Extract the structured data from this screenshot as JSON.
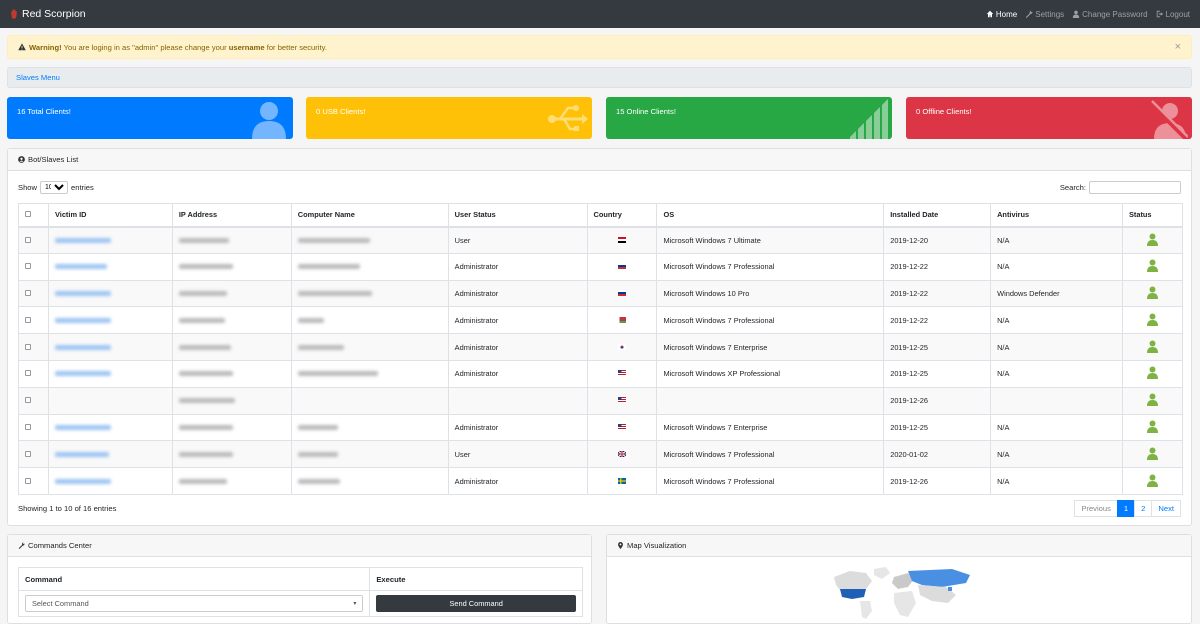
{
  "app": {
    "title": "Red Scorpion"
  },
  "nav": [
    {
      "label": "Home",
      "icon": "home-icon",
      "active": true
    },
    {
      "label": "Settings",
      "icon": "wrench-icon",
      "active": false
    },
    {
      "label": "Change Password",
      "icon": "user-icon",
      "active": false
    },
    {
      "label": "Logout",
      "icon": "logout-icon",
      "active": false
    }
  ],
  "alert": {
    "strong": "Warning!",
    "text_before": " You are loging in as \"admin\" please change your ",
    "emphasis": "username",
    "text_after": " for better security.",
    "close": "×"
  },
  "menu": {
    "label": "Slaves Menu"
  },
  "stats": [
    {
      "label": "16 Total Clients!",
      "color": "#007bff",
      "icon": "user-icon"
    },
    {
      "label": "0 USB Clients!",
      "color": "#ffc107",
      "icon": "usb-icon"
    },
    {
      "label": "15 Online Clients!",
      "color": "#28a745",
      "icon": "signal-icon"
    },
    {
      "label": "0 Offline Clients!",
      "color": "#dc3545",
      "icon": "user-slash-icon"
    }
  ],
  "slaves": {
    "title": "Bot/Slaves List",
    "show_label": "Show",
    "entries_value": "10",
    "entries_label": "entries",
    "search_label": "Search:",
    "columns": [
      "Victim ID",
      "IP Address",
      "Computer Name",
      "User Status",
      "Country",
      "OS",
      "Installed Date",
      "Antivirus",
      "Status"
    ],
    "rows": [
      {
        "user_status": "User",
        "flag": "eg",
        "os": "Microsoft Windows 7 Ultimate",
        "date": "2019-12-20",
        "av": "N/A",
        "blank": false
      },
      {
        "user_status": "Administrator",
        "flag": "ru",
        "os": "Microsoft Windows 7 Professional",
        "date": "2019-12-22",
        "av": "N/A",
        "blank": false
      },
      {
        "user_status": "Administrator",
        "flag": "ru",
        "os": "Microsoft Windows 10 Pro",
        "date": "2019-12-22",
        "av": "Windows Defender",
        "blank": false
      },
      {
        "user_status": "Administrator",
        "flag": "by",
        "os": "Microsoft Windows 7 Professional",
        "date": "2019-12-22",
        "av": "N/A",
        "blank": false
      },
      {
        "user_status": "Administrator",
        "flag": "kr",
        "os": "Microsoft Windows 7 Enterprise",
        "date": "2019-12-25",
        "av": "N/A",
        "blank": false
      },
      {
        "user_status": "Administrator",
        "flag": "us",
        "os": "Microsoft Windows XP Professional",
        "date": "2019-12-25",
        "av": "N/A",
        "blank": false
      },
      {
        "user_status": "",
        "flag": "us",
        "os": "",
        "date": "2019-12-26",
        "av": "",
        "blank": true
      },
      {
        "user_status": "Administrator",
        "flag": "us",
        "os": "Microsoft Windows 7 Enterprise",
        "date": "2019-12-25",
        "av": "N/A",
        "blank": false
      },
      {
        "user_status": "User",
        "flag": "gb",
        "os": "Microsoft Windows 7 Professional",
        "date": "2020-01-02",
        "av": "N/A",
        "blank": false
      },
      {
        "user_status": "Administrator",
        "flag": "se",
        "os": "Microsoft Windows 7 Professional",
        "date": "2019-12-26",
        "av": "N/A",
        "blank": false
      }
    ],
    "info": "Showing 1 to 10 of 16 entries",
    "pager": {
      "previous": "Previous",
      "pages": [
        "1",
        "2"
      ],
      "next": "Next"
    }
  },
  "commands": {
    "title": "Commands Center",
    "col_command": "Command",
    "col_execute": "Execute",
    "select_placeholder": "Select Command",
    "send_label": "Send Command"
  },
  "map": {
    "title": "Map Visualization"
  },
  "colors": {
    "navbar": "#343a40",
    "online": "#7cb342",
    "link": "#007bff",
    "map_highlight": "#4a90e2"
  }
}
